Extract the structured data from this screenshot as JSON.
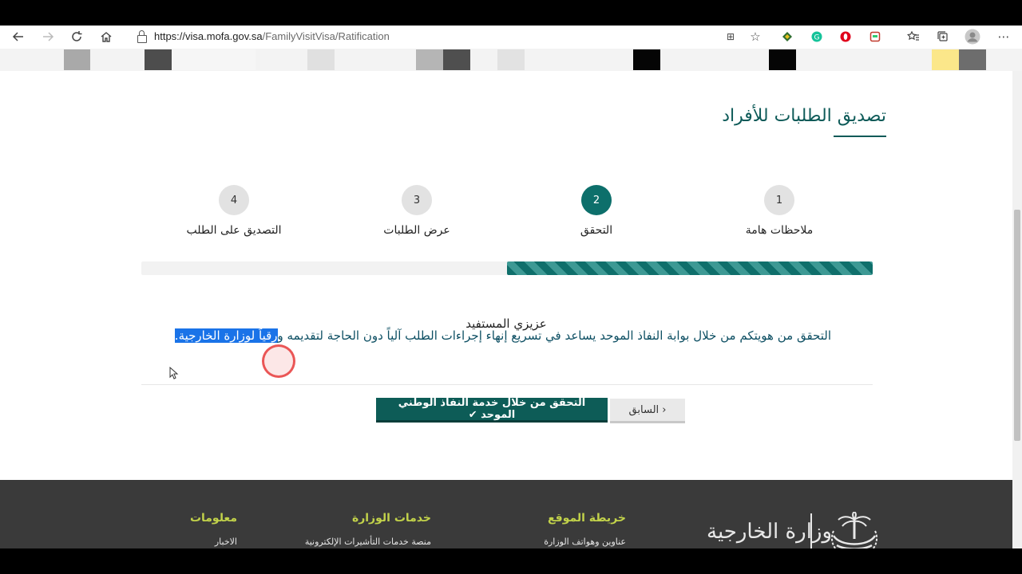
{
  "browser": {
    "url_host": "https://visa.mofa.gov.sa",
    "url_path": "/FamilyVisitVisa/Ratification",
    "icons": [
      "back-arrow-icon",
      "forward-arrow-icon",
      "reload-icon",
      "home-icon",
      "translate-icon",
      "star-icon",
      "extension-icon",
      "grammarly-icon",
      "opera-icon",
      "shield-extension-icon",
      "favorites-icon",
      "collections-icon",
      "profile-icon",
      "more-icon"
    ]
  },
  "page": {
    "title": "تصديق الطلبات للأفراد",
    "steps": [
      {
        "number": "1",
        "label": "ملاحظات هامة",
        "active": false
      },
      {
        "number": "2",
        "label": "التحقق",
        "active": true
      },
      {
        "number": "3",
        "label": "عرض الطلبات",
        "active": false
      },
      {
        "number": "4",
        "label": "التصديق على الطلب",
        "active": false
      }
    ],
    "progress_percent": 50,
    "greeting": "عزيزي المستفيد",
    "message_main": "التحقق من هويتكم من خلال بوابة النفاذ الموحد يساعد في تسريع إنهاء إجراءات الطلب آلياً دون الحاجة لتقديمه و",
    "message_highlight": "رقياً لوزارة الخارجية.",
    "primary_button": "التحقق من خلال خدمة النفاذ الوطني الموحد ✔",
    "secondary_button": "‹ السابق",
    "colors": {
      "primary": "#0d5c57",
      "accent": "#c2d24a",
      "footer": "#3a3a3a"
    }
  },
  "footer": {
    "logo_text": "وزارة الخارجية",
    "columns": [
      {
        "heading": "خريطة الموقع",
        "link": "عناوين وهواتف الوزارة"
      },
      {
        "heading": "خدمات الوزارة",
        "link": "منصة خدمات التأشيرات الإلكترونية"
      },
      {
        "heading": "معلومات",
        "link": "الاخبار"
      }
    ]
  }
}
